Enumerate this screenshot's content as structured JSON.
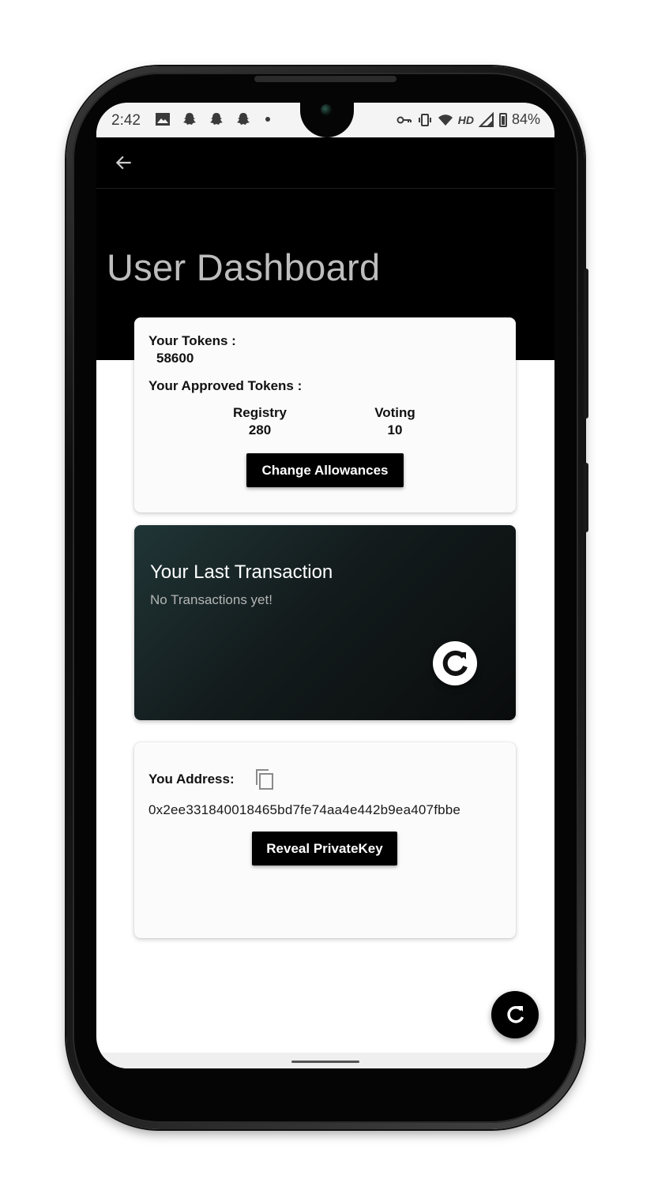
{
  "status_bar": {
    "time": "2:42",
    "battery": "84%",
    "network_label": "HD",
    "icons": [
      "image-icon",
      "snapchat-icon",
      "snapchat-icon",
      "snapchat-icon",
      "dot-icon",
      "key-icon",
      "vibrate-icon",
      "wifi-icon",
      "signal-icon",
      "battery-icon"
    ]
  },
  "app_bar": {
    "back_icon": "arrow-left-icon"
  },
  "page": {
    "title": "User Dashboard"
  },
  "tokens_card": {
    "your_tokens_label": "Your Tokens :",
    "your_tokens_value": "58600",
    "approved_label": "Your Approved Tokens :",
    "registry_label": "Registry",
    "registry_value": "280",
    "voting_label": "Voting",
    "voting_value": "10",
    "change_button": "Change Allowances"
  },
  "transaction_card": {
    "title": "Your Last Transaction",
    "subtitle": "No Transactions yet!",
    "refresh_icon": "refresh-icon"
  },
  "address_card": {
    "label": "You Address:",
    "copy_icon": "copy-icon",
    "address": "0x2ee331840018465bd7fe74aa4e442b9ea407fbbe",
    "reveal_button": "Reveal PrivateKey"
  },
  "fab": {
    "icon": "refresh-icon"
  },
  "colors": {
    "header_bg": "#000000",
    "card_bg": "#fbfbfb",
    "tx_card_start": "#203536",
    "tx_card_end": "#0a0c0c",
    "button_bg": "#000000"
  }
}
